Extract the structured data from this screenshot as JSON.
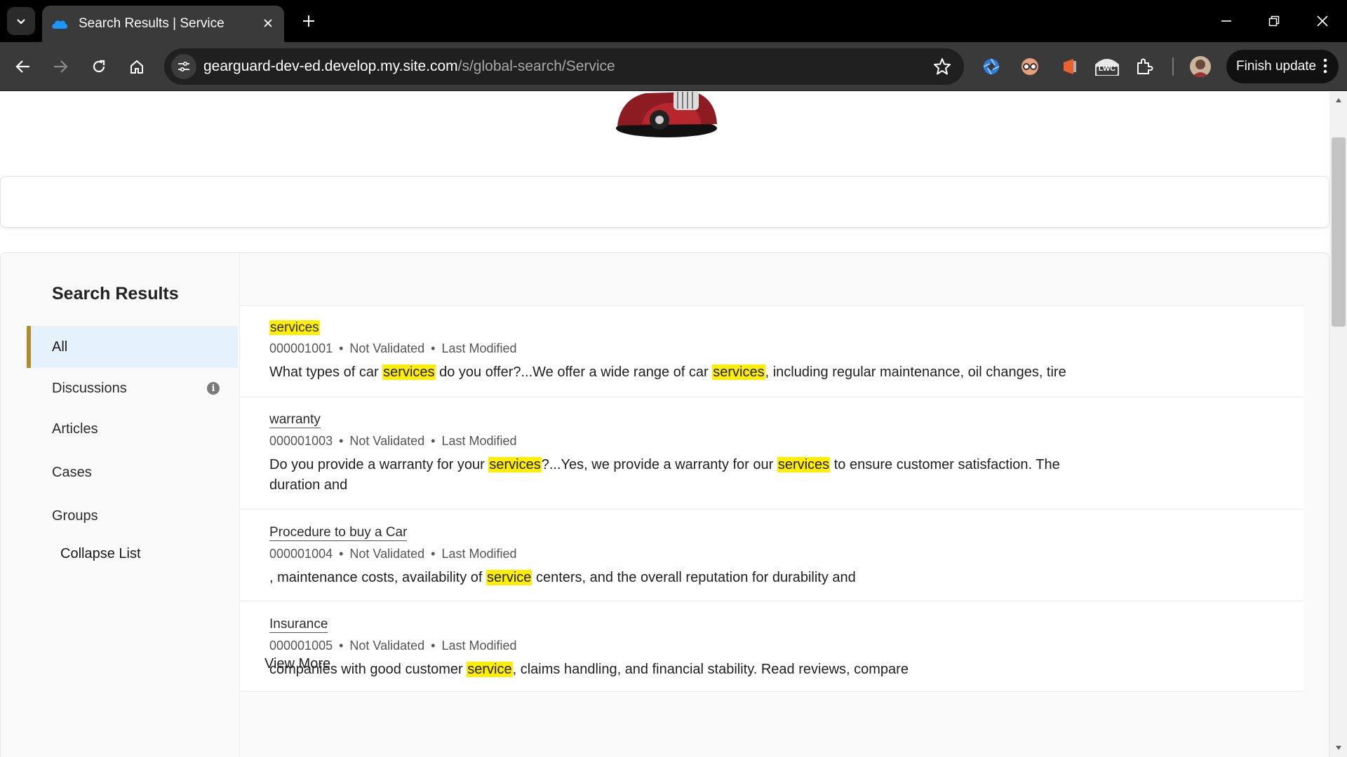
{
  "browser": {
    "tab_title": "Search Results | Service",
    "url_host": "gearguard-dev-ed.develop.my.site.com",
    "url_path": "/s/global-search/Service",
    "finish_update": "Finish update",
    "extension_lwc_label": "LWC"
  },
  "nav": {
    "title": "Search Results",
    "items": [
      {
        "label": "All"
      },
      {
        "label": "Discussions"
      },
      {
        "label": "Articles"
      },
      {
        "label": "Cases"
      },
      {
        "label": "Groups"
      }
    ],
    "collapse_label": "Collapse List"
  },
  "results": [
    {
      "title": "services",
      "number": "000001001",
      "status": "Not Validated",
      "modified": "Last Modified",
      "snippet_parts": [
        "What types of car ",
        "services",
        " do you offer?...We offer a wide range of car ",
        "services",
        ", including regular maintenance, oil changes, tire"
      ]
    },
    {
      "title": "warranty",
      "number": "000001003",
      "status": "Not Validated",
      "modified": "Last Modified",
      "snippet_parts": [
        "Do you provide a warranty for your ",
        "services",
        "?...Yes, we provide a warranty for our ",
        "services",
        " to ensure customer satisfaction. The duration and"
      ]
    },
    {
      "title": "Procedure to buy a Car",
      "number": "000001004",
      "status": "Not Validated",
      "modified": "Last Modified",
      "snippet_parts": [
        ", maintenance costs, availability of ",
        "service",
        " centers, and the overall reputation for durability and"
      ]
    },
    {
      "title": "Insurance",
      "number": "000001005",
      "status": "Not Validated",
      "modified": "Last Modified",
      "snippet_parts": [
        "companies with good customer ",
        "service",
        ", claims handling, and financial stability. Read reviews, compare"
      ]
    }
  ],
  "view_more": "View More",
  "separator": "•",
  "colors": {
    "highlight": "#ffee00",
    "active_nav_bg": "#e5f1fb",
    "active_nav_bar": "#b08c2c"
  }
}
